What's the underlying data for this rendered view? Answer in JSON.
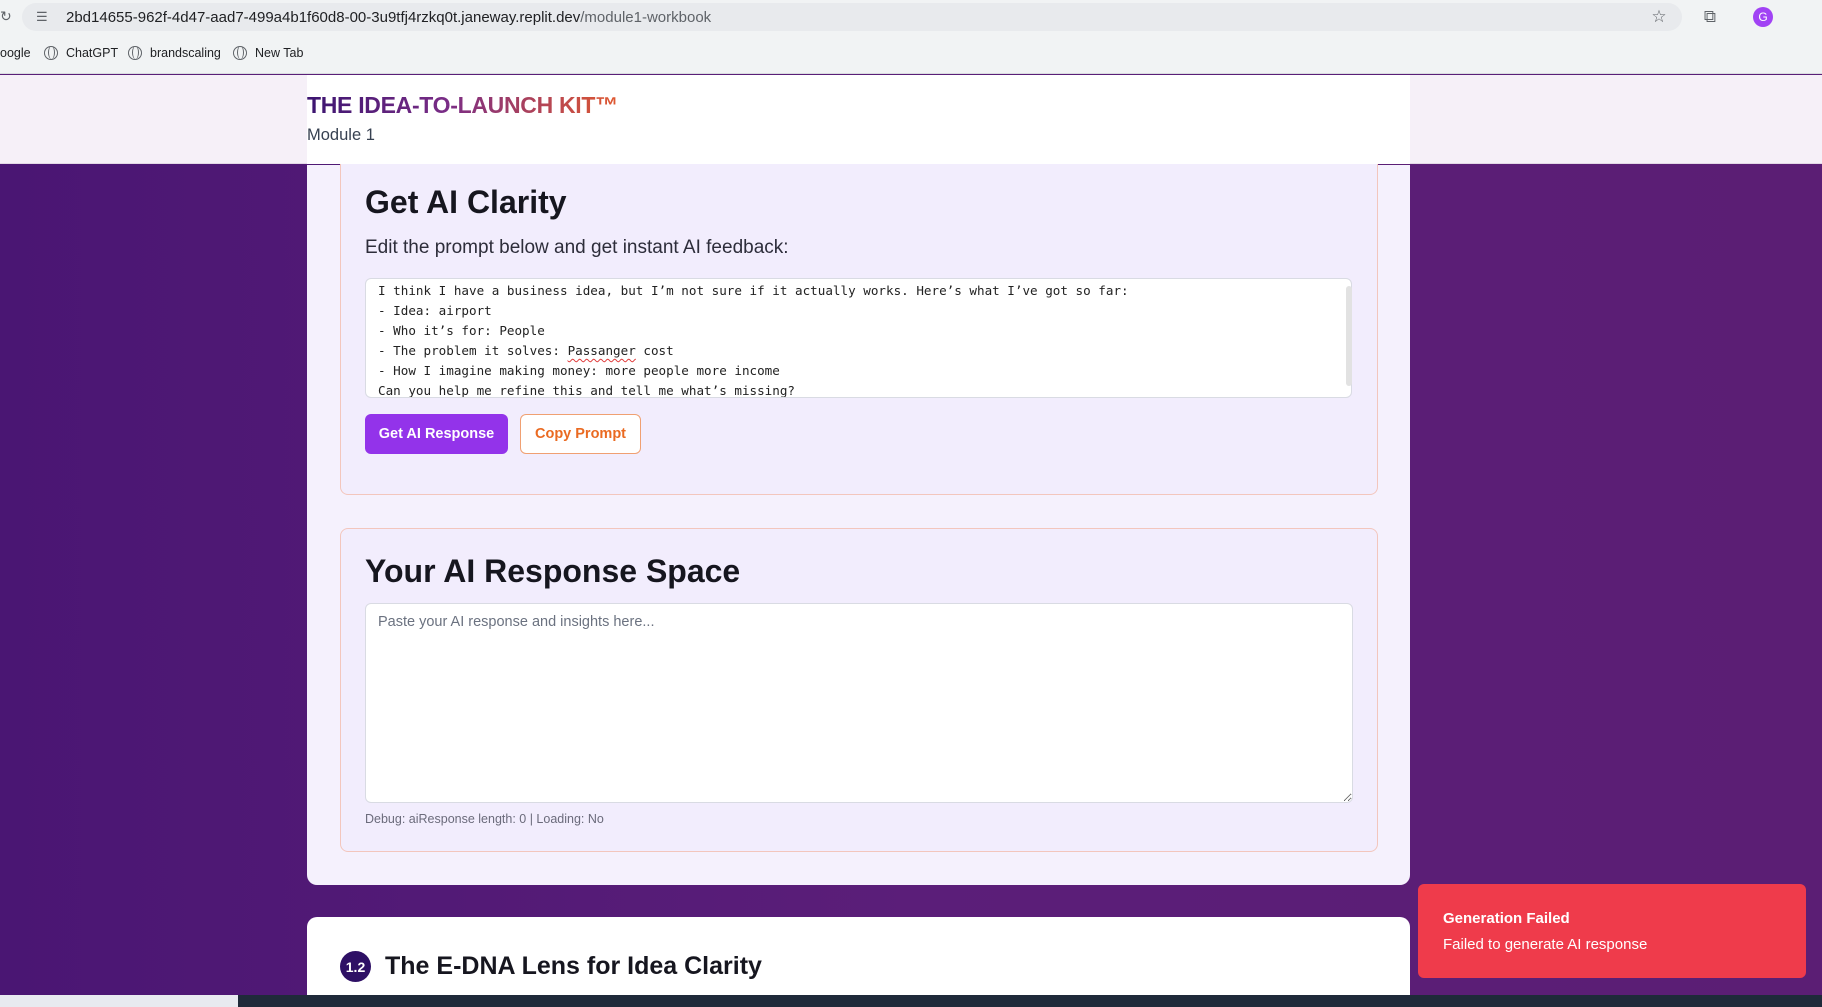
{
  "browser": {
    "url_host": "2bd14655-962f-4d47-aad7-499a4b1f60d8-00-3u9tfj4rzkq0t.janeway.replit.dev",
    "url_path": "/module1-workbook",
    "avatar_letter": "G",
    "bookmarks": [
      {
        "label": "oogle"
      },
      {
        "label": "ChatGPT"
      },
      {
        "label": "brandscaling"
      },
      {
        "label": "New Tab"
      }
    ]
  },
  "header": {
    "brand": "THE IDEA-TO-LAUNCH KIT™",
    "subtitle": "Module 1"
  },
  "clarity": {
    "title": "Get AI Clarity",
    "lead": "Edit the prompt below and get instant AI feedback:",
    "prompt_lines": {
      "l1": "I think I have a business idea, but I’m not sure if it actually works. Here’s what I’ve got so far:",
      "l2": "- Idea: airport",
      "l3": "- Who it’s for: People",
      "l4_prefix": "- The problem it solves: ",
      "l4_misspelled": "Passanger",
      "l4_suffix": " cost",
      "l5": "- How I imagine making money: more people more income",
      "l6": "Can you help me refine this and tell me what’s missing?"
    },
    "primary_button": "Get AI Response",
    "secondary_button": "Copy Prompt"
  },
  "response": {
    "title": "Your AI Response Space",
    "placeholder": "Paste your AI response and insights here...",
    "value": "",
    "debug": "Debug: aiResponse length: 0 | Loading: No"
  },
  "next_section": {
    "badge": "1.2",
    "title": "The E-DNA Lens for Idea Clarity"
  },
  "toast": {
    "title": "Generation Failed",
    "message": "Failed to generate AI response"
  },
  "colors": {
    "page_bg": "#5a1f78",
    "primary_button": "#9333ea",
    "outline_accent": "#ea6a21",
    "toast_bg": "#ef3b4b",
    "badge_bg": "#2e1065"
  },
  "icons": {
    "site_info": "tune-icon",
    "bookmark": "globe-icon",
    "star": "star-icon",
    "extensions": "puzzle-icon"
  }
}
